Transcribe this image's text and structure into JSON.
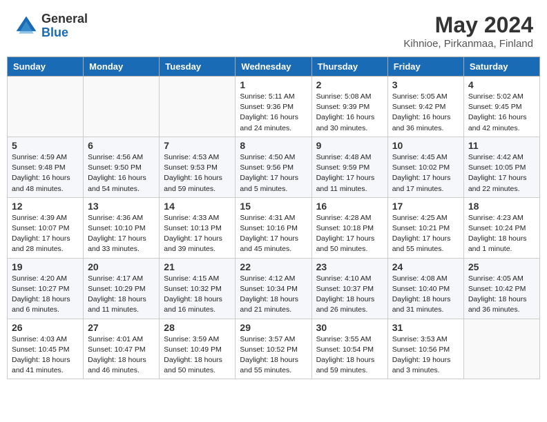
{
  "header": {
    "logo_general": "General",
    "logo_blue": "Blue",
    "month_title": "May 2024",
    "subtitle": "Kihnioe, Pirkanmaa, Finland"
  },
  "weekdays": [
    "Sunday",
    "Monday",
    "Tuesday",
    "Wednesday",
    "Thursday",
    "Friday",
    "Saturday"
  ],
  "weeks": [
    [
      {
        "day": "",
        "info": ""
      },
      {
        "day": "",
        "info": ""
      },
      {
        "day": "",
        "info": ""
      },
      {
        "day": "1",
        "info": "Sunrise: 5:11 AM\nSunset: 9:36 PM\nDaylight: 16 hours\nand 24 minutes."
      },
      {
        "day": "2",
        "info": "Sunrise: 5:08 AM\nSunset: 9:39 PM\nDaylight: 16 hours\nand 30 minutes."
      },
      {
        "day": "3",
        "info": "Sunrise: 5:05 AM\nSunset: 9:42 PM\nDaylight: 16 hours\nand 36 minutes."
      },
      {
        "day": "4",
        "info": "Sunrise: 5:02 AM\nSunset: 9:45 PM\nDaylight: 16 hours\nand 42 minutes."
      }
    ],
    [
      {
        "day": "5",
        "info": "Sunrise: 4:59 AM\nSunset: 9:48 PM\nDaylight: 16 hours\nand 48 minutes."
      },
      {
        "day": "6",
        "info": "Sunrise: 4:56 AM\nSunset: 9:50 PM\nDaylight: 16 hours\nand 54 minutes."
      },
      {
        "day": "7",
        "info": "Sunrise: 4:53 AM\nSunset: 9:53 PM\nDaylight: 16 hours\nand 59 minutes."
      },
      {
        "day": "8",
        "info": "Sunrise: 4:50 AM\nSunset: 9:56 PM\nDaylight: 17 hours\nand 5 minutes."
      },
      {
        "day": "9",
        "info": "Sunrise: 4:48 AM\nSunset: 9:59 PM\nDaylight: 17 hours\nand 11 minutes."
      },
      {
        "day": "10",
        "info": "Sunrise: 4:45 AM\nSunset: 10:02 PM\nDaylight: 17 hours\nand 17 minutes."
      },
      {
        "day": "11",
        "info": "Sunrise: 4:42 AM\nSunset: 10:05 PM\nDaylight: 17 hours\nand 22 minutes."
      }
    ],
    [
      {
        "day": "12",
        "info": "Sunrise: 4:39 AM\nSunset: 10:07 PM\nDaylight: 17 hours\nand 28 minutes."
      },
      {
        "day": "13",
        "info": "Sunrise: 4:36 AM\nSunset: 10:10 PM\nDaylight: 17 hours\nand 33 minutes."
      },
      {
        "day": "14",
        "info": "Sunrise: 4:33 AM\nSunset: 10:13 PM\nDaylight: 17 hours\nand 39 minutes."
      },
      {
        "day": "15",
        "info": "Sunrise: 4:31 AM\nSunset: 10:16 PM\nDaylight: 17 hours\nand 45 minutes."
      },
      {
        "day": "16",
        "info": "Sunrise: 4:28 AM\nSunset: 10:18 PM\nDaylight: 17 hours\nand 50 minutes."
      },
      {
        "day": "17",
        "info": "Sunrise: 4:25 AM\nSunset: 10:21 PM\nDaylight: 17 hours\nand 55 minutes."
      },
      {
        "day": "18",
        "info": "Sunrise: 4:23 AM\nSunset: 10:24 PM\nDaylight: 18 hours\nand 1 minute."
      }
    ],
    [
      {
        "day": "19",
        "info": "Sunrise: 4:20 AM\nSunset: 10:27 PM\nDaylight: 18 hours\nand 6 minutes."
      },
      {
        "day": "20",
        "info": "Sunrise: 4:17 AM\nSunset: 10:29 PM\nDaylight: 18 hours\nand 11 minutes."
      },
      {
        "day": "21",
        "info": "Sunrise: 4:15 AM\nSunset: 10:32 PM\nDaylight: 18 hours\nand 16 minutes."
      },
      {
        "day": "22",
        "info": "Sunrise: 4:12 AM\nSunset: 10:34 PM\nDaylight: 18 hours\nand 21 minutes."
      },
      {
        "day": "23",
        "info": "Sunrise: 4:10 AM\nSunset: 10:37 PM\nDaylight: 18 hours\nand 26 minutes."
      },
      {
        "day": "24",
        "info": "Sunrise: 4:08 AM\nSunset: 10:40 PM\nDaylight: 18 hours\nand 31 minutes."
      },
      {
        "day": "25",
        "info": "Sunrise: 4:05 AM\nSunset: 10:42 PM\nDaylight: 18 hours\nand 36 minutes."
      }
    ],
    [
      {
        "day": "26",
        "info": "Sunrise: 4:03 AM\nSunset: 10:45 PM\nDaylight: 18 hours\nand 41 minutes."
      },
      {
        "day": "27",
        "info": "Sunrise: 4:01 AM\nSunset: 10:47 PM\nDaylight: 18 hours\nand 46 minutes."
      },
      {
        "day": "28",
        "info": "Sunrise: 3:59 AM\nSunset: 10:49 PM\nDaylight: 18 hours\nand 50 minutes."
      },
      {
        "day": "29",
        "info": "Sunrise: 3:57 AM\nSunset: 10:52 PM\nDaylight: 18 hours\nand 55 minutes."
      },
      {
        "day": "30",
        "info": "Sunrise: 3:55 AM\nSunset: 10:54 PM\nDaylight: 18 hours\nand 59 minutes."
      },
      {
        "day": "31",
        "info": "Sunrise: 3:53 AM\nSunset: 10:56 PM\nDaylight: 19 hours\nand 3 minutes."
      },
      {
        "day": "",
        "info": ""
      }
    ]
  ]
}
